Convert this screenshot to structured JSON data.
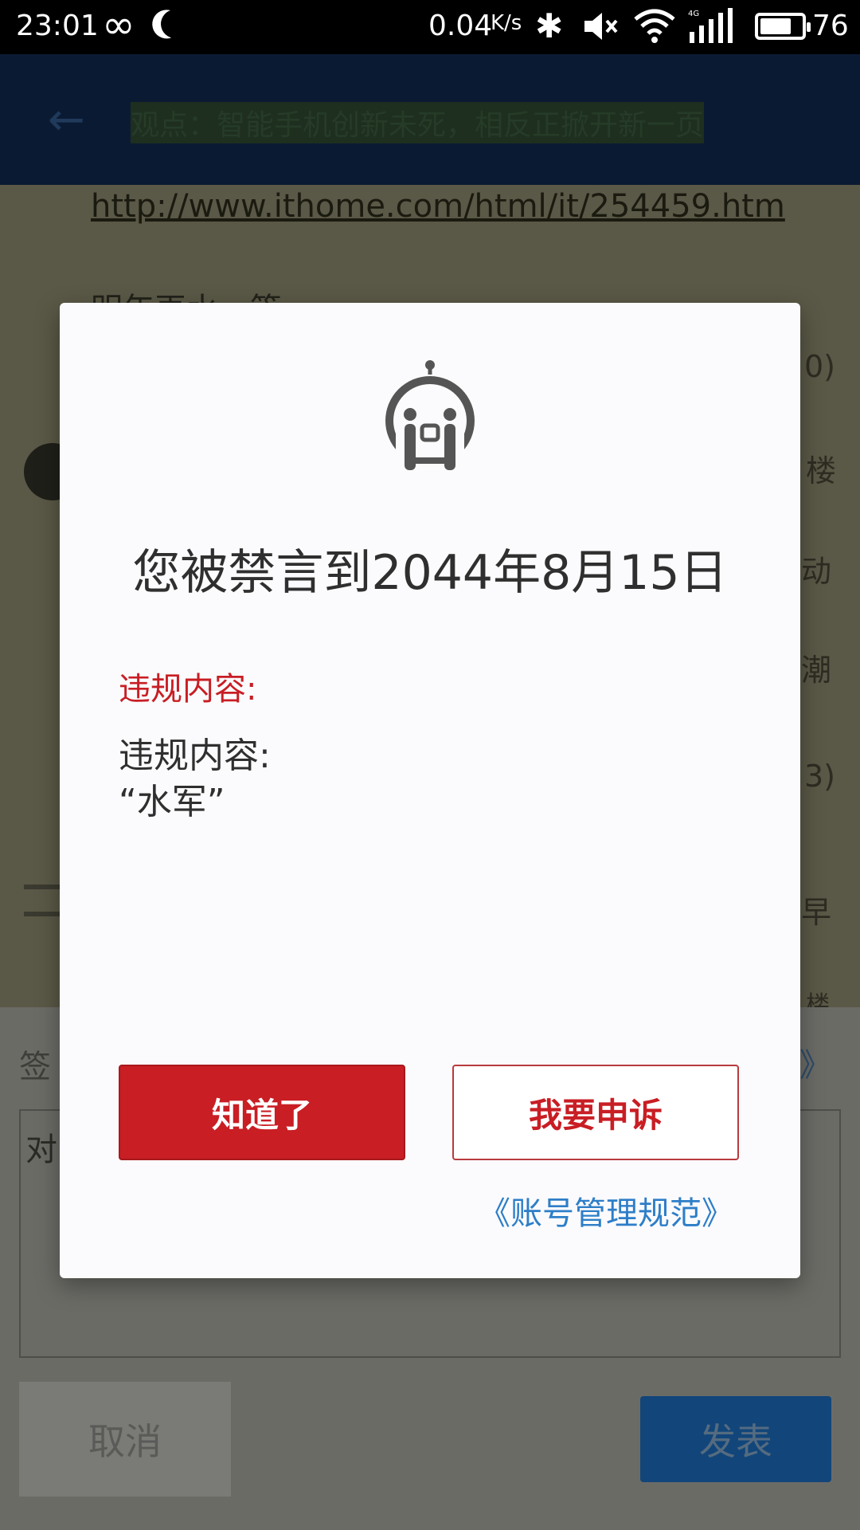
{
  "status_bar": {
    "time": "23:01",
    "speed": "0.04",
    "speed_unit": "K/s",
    "battery": "76",
    "battery_fraction": 0.76,
    "network_type": "4G",
    "icons": [
      "infinity-icon",
      "moon-icon",
      "bluetooth-icon",
      "mute-icon",
      "wifi-icon",
      "signal-icon",
      "battery-icon"
    ]
  },
  "background": {
    "header_title": "观点：智能手机创新未死，相反正掀开新一页",
    "link": "http://www.ithome.com/html/it/254459.htm",
    "text_fragment": "明年再水一篇",
    "side_fragments": [
      "0)",
      "楼",
      "动",
      "潮",
      "3)",
      "早",
      "楼"
    ],
    "sign_label": "签",
    "guide_fragment": "》",
    "textarea_fragment": "对",
    "cancel_label": "取消",
    "publish_label": "发表"
  },
  "dialog": {
    "title": "您被禁言到2044年8月15日",
    "violation_label": "违规内容:",
    "violation_body_line1": "违规内容:",
    "violation_body_line2": "“水军”",
    "ok_button": "知道了",
    "appeal_button": "我要申诉",
    "rules_link": "《账号管理规范》"
  },
  "colors": {
    "accent_red": "#c81e24",
    "link_blue": "#2e7ec8",
    "publish_blue": "#12467a"
  }
}
